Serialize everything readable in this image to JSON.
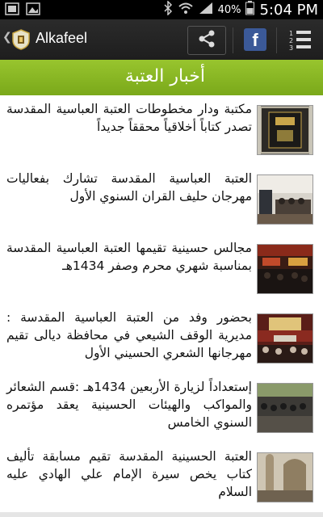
{
  "status_bar": {
    "battery_percent": "40%",
    "time": "5:04 PM"
  },
  "app_bar": {
    "title": "Alkafeel",
    "fb_label": "f",
    "menu_icon_label": "123"
  },
  "section": {
    "title": "أخبار العتبة"
  },
  "news": [
    {
      "text": "مكتبة ودار مخطوطات العتبة العباسية المقدسة تصدر كتاباً أخلاقياً محققاً جديداً"
    },
    {
      "text": "العتبة العباسية المقدسة تشارك بفعاليات مهرجان حليف القران السنوي الأول"
    },
    {
      "text": "مجالس حسينية تقيمها العتبة العباسية المقدسة بمناسبة شهري محرم وصفر 1434هـ"
    },
    {
      "text": "بحضور وفد من العتبة العباسية المقدسة : مديرية الوقف الشيعي في محافظة ديالى تقيم مهرجانها الشعري الحسيني الأول"
    },
    {
      "text": "إستعداداً لزيارة الأربعين 1434هـ :قسم الشعائر والمواكب والهيئات الحسينية يعقد مؤتمره السنوي الخامس"
    },
    {
      "text": "العتبة الحسينية المقدسة تقيم مسابقة تأليف كتاب يخص سيرة الإمام علي الهادي عليه السلام"
    }
  ]
}
